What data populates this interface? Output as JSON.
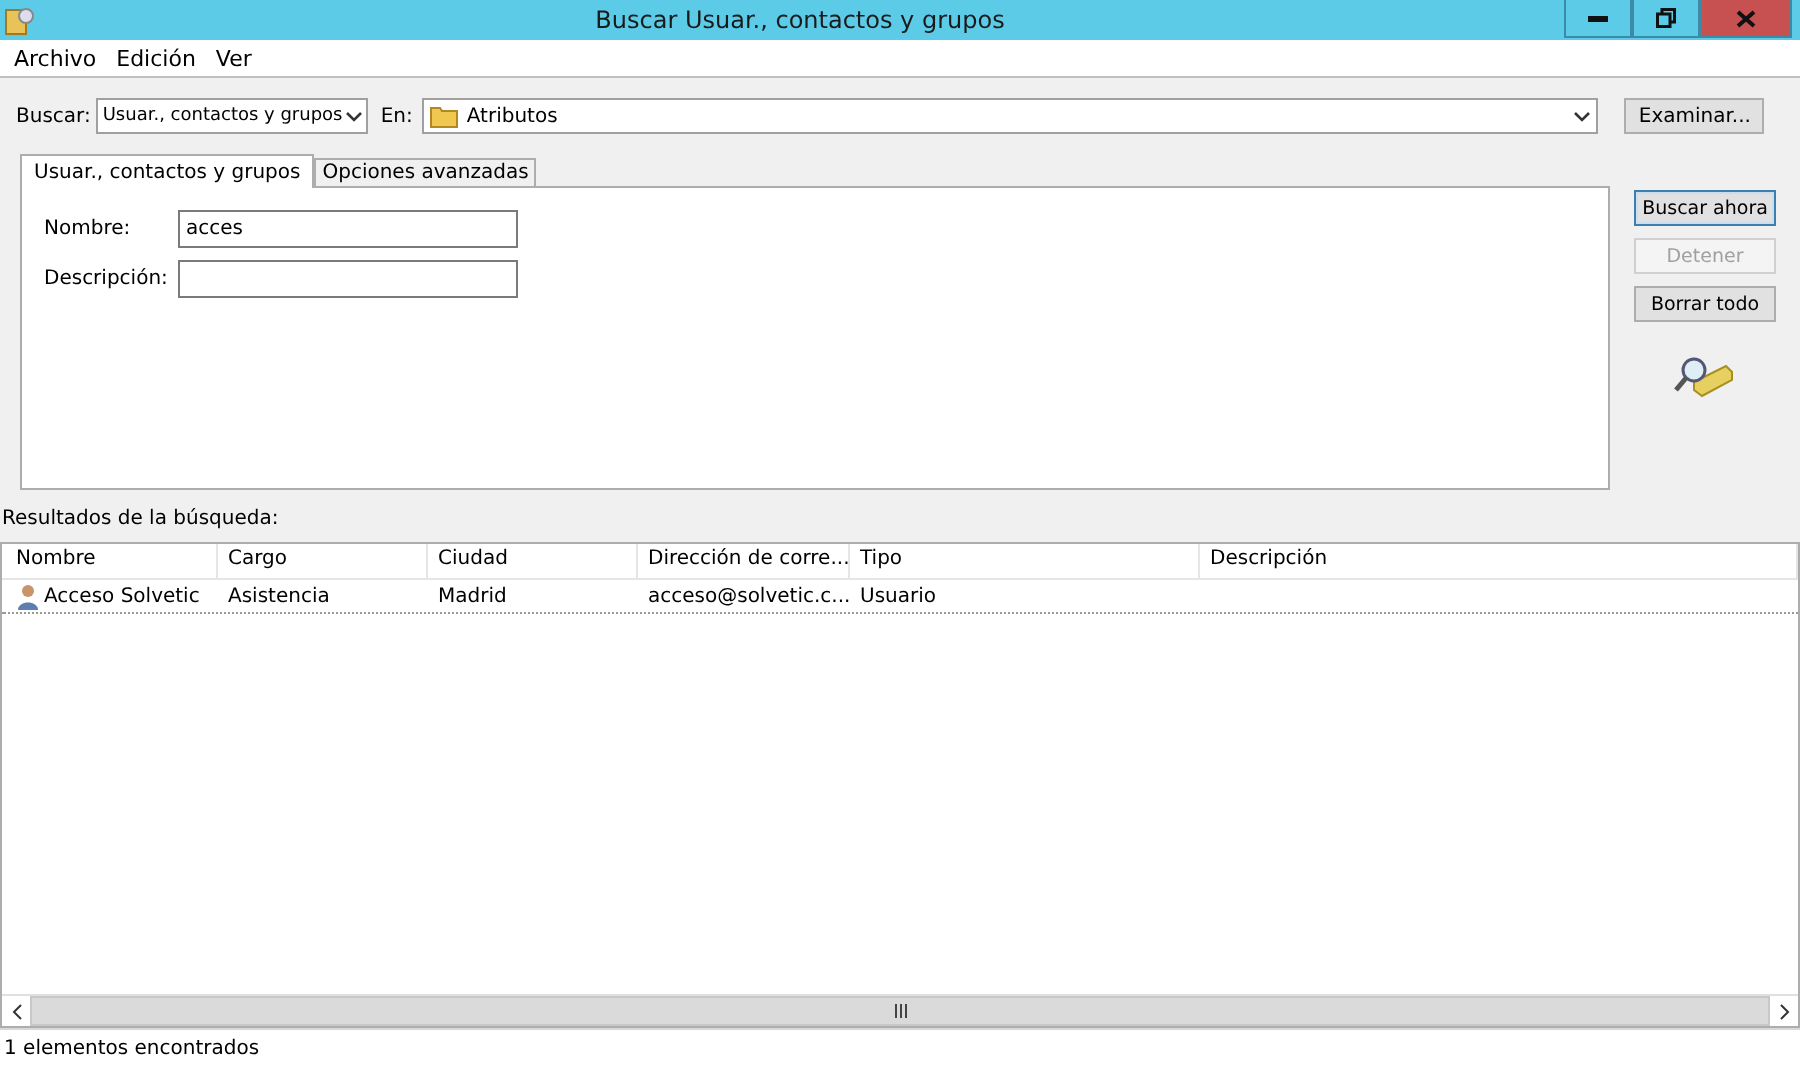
{
  "window": {
    "title": "Buscar Usuar., contactos y grupos"
  },
  "menu": [
    "Archivo",
    "Edición",
    "Ver"
  ],
  "search_bar": {
    "find_label": "Buscar:",
    "find_value": "Usuar., contactos y grupos",
    "in_label": "En:",
    "in_value": "Atributos",
    "browse_button": "Examinar..."
  },
  "tabs": [
    {
      "label": "Usuar., contactos y grupos",
      "selected": true
    },
    {
      "label": "Opciones avanzadas",
      "selected": false
    }
  ],
  "fields": [
    {
      "label": "Nombre:",
      "value": "acces"
    },
    {
      "label": "Descripción:"
    }
  ],
  "actions": [
    {
      "label": "Buscar ahora",
      "disabled": false
    },
    {
      "label": "Detener",
      "disabled": true
    },
    {
      "label": "Borrar todo",
      "disabled": false
    }
  ],
  "results_label": "Resultados de la búsqueda:",
  "table": {
    "columns": [
      "Nombre",
      "Cargo",
      "Ciudad",
      "Dirección de corre...",
      "Tipo",
      "Descripción"
    ],
    "rows": [
      {
        "selected": false,
        "cells": [
          "Acceso Solvetic",
          "Asistencia",
          "Madrid",
          "acceso@solvetic.c...",
          "Usuario"
        ]
      }
    ]
  },
  "status_bar": "1 elementos encontrados"
}
